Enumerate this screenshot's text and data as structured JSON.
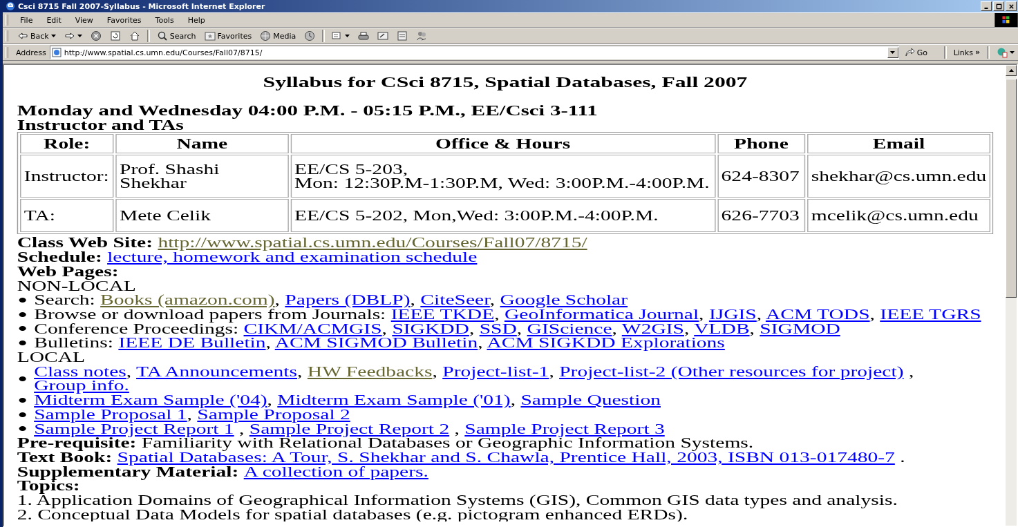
{
  "window": {
    "title": "Csci 8715 Fall 2007-Syllabus - Microsoft Internet Explorer"
  },
  "menu": [
    "File",
    "Edit",
    "View",
    "Favorites",
    "Tools",
    "Help"
  ],
  "toolbar": [
    {
      "kind": "back",
      "label": "Back",
      "dropdown": true
    },
    {
      "kind": "forward",
      "dropdown": true
    },
    {
      "kind": "stop"
    },
    {
      "kind": "refresh"
    },
    {
      "kind": "home"
    },
    {
      "kind": "separator"
    },
    {
      "kind": "search",
      "label": "Search"
    },
    {
      "kind": "favorites",
      "label": "Favorites"
    },
    {
      "kind": "media",
      "label": "Media"
    },
    {
      "kind": "history"
    },
    {
      "kind": "separator"
    },
    {
      "kind": "mail",
      "dropdown": true
    },
    {
      "kind": "print"
    },
    {
      "kind": "edit"
    },
    {
      "kind": "discuss"
    },
    {
      "kind": "messenger"
    }
  ],
  "address_bar": {
    "label": "Address",
    "url": "http://www.spatial.cs.umn.edu/Courses/Fall07/8715/",
    "go": "Go",
    "links": "Links",
    "links_more": "»"
  },
  "page": {
    "title": "Syllabus for CSci 8715, Spatial Databases, Fall 2007",
    "schedule": "Monday and Wednesday 04:00 P.M. - 05:15 P.M., EE/Csci 3-111",
    "section": "Instructor and TAs",
    "table": {
      "columns": [
        "Role:",
        "Name",
        "Office & Hours",
        "Phone",
        "Email"
      ],
      "rows": [
        [
          "Instructor:",
          "Prof. Shashi Shekhar",
          "EE/CS 5-203,\nMon: 12:30P.M-1:30P.M, Wed: 3:00P.M.-4:00P.M.",
          "624-8307",
          "shekhar@cs.umn.edu"
        ],
        [
          "TA:",
          "Mete Celik",
          "EE/CS 5-202, Mon,Wed: 3:00P.M.-4:00P.M.",
          "626-7703",
          "mcelik@cs.umn.edu"
        ]
      ]
    },
    "lines": [
      {
        "kind": "plain",
        "parts": [
          {
            "kind": "bold",
            "text": "Class Web Site: "
          },
          {
            "kind": "link",
            "text": "http://www.spatial.cs.umn.edu/Courses/Fall07/8715/",
            "visited": true
          }
        ]
      },
      {
        "kind": "plain",
        "parts": [
          {
            "kind": "bold",
            "text": "Schedule: "
          },
          {
            "kind": "link",
            "text": "lecture, homework and examination schedule",
            "visited": false
          }
        ]
      },
      {
        "kind": "plain",
        "parts": [
          {
            "kind": "bold",
            "text": "Web Pages:"
          }
        ]
      },
      {
        "kind": "plain",
        "parts": [
          {
            "kind": "text",
            "text": "NON-LOCAL"
          }
        ]
      },
      {
        "kind": "bullet",
        "parts": [
          {
            "kind": "text",
            "text": "Search: "
          },
          {
            "kind": "link",
            "text": "Books (amazon.com)",
            "visited": true
          },
          {
            "kind": "text",
            "text": ", "
          },
          {
            "kind": "link",
            "text": "Papers (DBLP)",
            "visited": false
          },
          {
            "kind": "text",
            "text": ", "
          },
          {
            "kind": "link",
            "text": "CiteSeer",
            "visited": false
          },
          {
            "kind": "text",
            "text": ", "
          },
          {
            "kind": "link",
            "text": "Google Scholar",
            "visited": false
          }
        ]
      },
      {
        "kind": "bullet",
        "parts": [
          {
            "kind": "text",
            "text": "Browse or download papers from Journals: "
          },
          {
            "kind": "link",
            "text": "IEEE TKDE",
            "visited": false
          },
          {
            "kind": "text",
            "text": ", "
          },
          {
            "kind": "link",
            "text": "GeoInformatica Journal",
            "visited": false
          },
          {
            "kind": "text",
            "text": ", "
          },
          {
            "kind": "link",
            "text": "IJGIS",
            "visited": false
          },
          {
            "kind": "text",
            "text": ", "
          },
          {
            "kind": "link",
            "text": "ACM TODS",
            "visited": false
          },
          {
            "kind": "text",
            "text": ", "
          },
          {
            "kind": "link",
            "text": "IEEE TGRS",
            "visited": false
          }
        ]
      },
      {
        "kind": "bullet",
        "parts": [
          {
            "kind": "text",
            "text": "Conference Proceedings: "
          },
          {
            "kind": "link",
            "text": "CIKM/ACMGIS",
            "visited": false
          },
          {
            "kind": "text",
            "text": ", "
          },
          {
            "kind": "link",
            "text": "SIGKDD",
            "visited": false
          },
          {
            "kind": "text",
            "text": ", "
          },
          {
            "kind": "link",
            "text": "SSD",
            "visited": false
          },
          {
            "kind": "text",
            "text": ", "
          },
          {
            "kind": "link",
            "text": "GIScience",
            "visited": false
          },
          {
            "kind": "text",
            "text": ", "
          },
          {
            "kind": "link",
            "text": "W2GIS",
            "visited": false
          },
          {
            "kind": "text",
            "text": ", "
          },
          {
            "kind": "link",
            "text": "VLDB",
            "visited": false
          },
          {
            "kind": "text",
            "text": ", "
          },
          {
            "kind": "link",
            "text": "SIGMOD",
            "visited": false
          }
        ]
      },
      {
        "kind": "bullet",
        "parts": [
          {
            "kind": "text",
            "text": "Bulletins: "
          },
          {
            "kind": "link",
            "text": "IEEE DE Bulletin",
            "visited": false
          },
          {
            "kind": "text",
            "text": ", "
          },
          {
            "kind": "link",
            "text": "ACM SIGMOD Bulletin",
            "visited": false
          },
          {
            "kind": "text",
            "text": ", "
          },
          {
            "kind": "link",
            "text": "ACM SIGKDD Explorations",
            "visited": false
          }
        ]
      },
      {
        "kind": "plain",
        "parts": [
          {
            "kind": "text",
            "text": "LOCAL"
          }
        ]
      },
      {
        "kind": "bullet",
        "parts": [
          {
            "kind": "link",
            "text": "Class notes",
            "visited": false
          },
          {
            "kind": "text",
            "text": ", "
          },
          {
            "kind": "link",
            "text": "TA Announcements",
            "visited": false
          },
          {
            "kind": "text",
            "text": ", "
          },
          {
            "kind": "link",
            "text": "HW Feedbacks",
            "visited": true
          },
          {
            "kind": "text",
            "text": ", "
          },
          {
            "kind": "link",
            "text": "Project-list-1",
            "visited": false
          },
          {
            "kind": "text",
            "text": ", "
          },
          {
            "kind": "link",
            "text": "Project-list-2 (Other resources for project)",
            "visited": false
          },
          {
            "kind": "text",
            "text": " , "
          },
          {
            "kind": "link",
            "text": "Group info.",
            "visited": false
          }
        ]
      },
      {
        "kind": "bullet",
        "parts": [
          {
            "kind": "link",
            "text": "Midterm Exam Sample ('04)",
            "visited": false
          },
          {
            "kind": "text",
            "text": ", "
          },
          {
            "kind": "link",
            "text": "Midterm Exam Sample ('01)",
            "visited": false
          },
          {
            "kind": "text",
            "text": ", "
          },
          {
            "kind": "link",
            "text": "Sample Question",
            "visited": false
          }
        ]
      },
      {
        "kind": "bullet",
        "parts": [
          {
            "kind": "link",
            "text": "Sample Proposal 1",
            "visited": false
          },
          {
            "kind": "text",
            "text": ", "
          },
          {
            "kind": "link",
            "text": "Sample Proposal 2",
            "visited": false
          }
        ]
      },
      {
        "kind": "bullet",
        "parts": [
          {
            "kind": "link",
            "text": "Sample Project Report 1",
            "visited": false
          },
          {
            "kind": "text",
            "text": " , "
          },
          {
            "kind": "link",
            "text": "Sample Project Report 2",
            "visited": false
          },
          {
            "kind": "text",
            "text": " , "
          },
          {
            "kind": "link",
            "text": "Sample Project Report 3",
            "visited": false
          }
        ]
      },
      {
        "kind": "plain",
        "parts": [
          {
            "kind": "bold",
            "text": "Pre-requisite: "
          },
          {
            "kind": "text",
            "text": "Familiarity with Relational Databases or Geographic Information Systems."
          }
        ]
      },
      {
        "kind": "plain",
        "parts": [
          {
            "kind": "bold",
            "text": "Text Book: "
          },
          {
            "kind": "link",
            "text": "Spatial Databases: A Tour, S. Shekhar and S. Chawla, Prentice Hall, 2003, ISBN 013-017480-7",
            "visited": false
          },
          {
            "kind": "text",
            "text": " ."
          }
        ]
      },
      {
        "kind": "plain",
        "parts": [
          {
            "kind": "bold",
            "text": "Supplementary Material: "
          },
          {
            "kind": "link",
            "text": "A collection of papers.",
            "visited": false
          }
        ]
      },
      {
        "kind": "plain",
        "parts": [
          {
            "kind": "bold",
            "text": "Topics:"
          }
        ]
      },
      {
        "kind": "plain",
        "parts": [
          {
            "kind": "text",
            "text": "1. Application Domains of Geographical Information Systems (GIS), Common GIS data types and analysis."
          }
        ]
      },
      {
        "kind": "plain",
        "parts": [
          {
            "kind": "text",
            "text": "2. Conceptual Data Models for spatial databases (e.g. pictogram enhanced ERDs)."
          }
        ]
      }
    ]
  }
}
